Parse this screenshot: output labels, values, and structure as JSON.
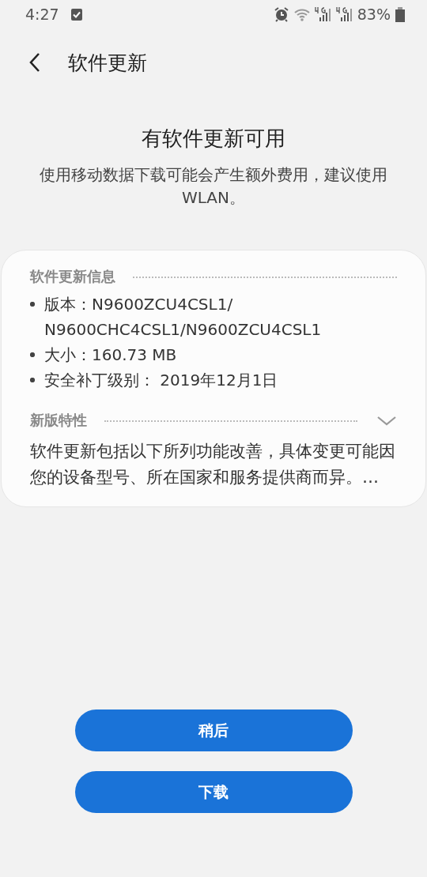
{
  "status_bar": {
    "time": "4:27",
    "battery": "83%"
  },
  "header": {
    "title": "软件更新"
  },
  "intro": {
    "heading": "有软件更新可用",
    "message": "使用移动数据下载可能会产生额外费用，建议使用 WLAN。"
  },
  "info_card": {
    "info_title": "软件更新信息",
    "info_items": [
      {
        "label": "版本：",
        "value": "N9600ZCU4CSL1/\nN9600CHC4CSL1/N9600ZCU4CSL1"
      },
      {
        "label": "大小：",
        "value": "160.73 MB"
      },
      {
        "label": "安全补丁级别：",
        "value": " 2019年12月1日"
      }
    ],
    "features_title": "新版特性",
    "features_expanded": false,
    "features_text": "软件更新包括以下所列功能改善，具体变更可能因您的设备型号、所在国家和服务提供商而异。…"
  },
  "buttons": [
    "稍后",
    "下载"
  ]
}
